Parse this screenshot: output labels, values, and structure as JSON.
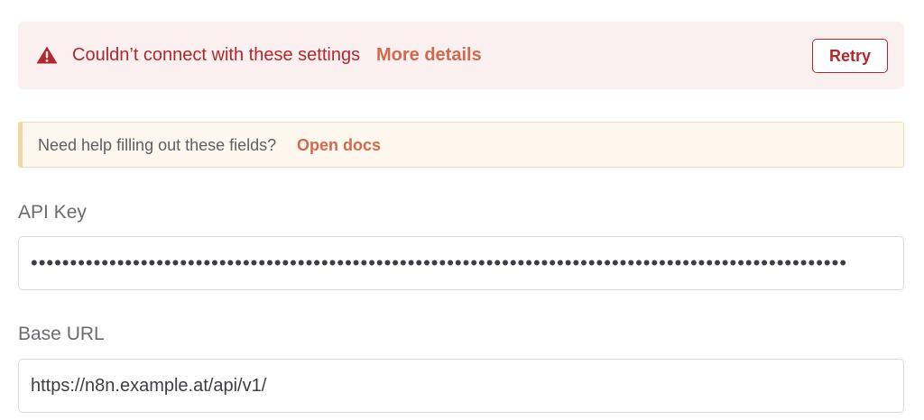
{
  "error_banner": {
    "message": "Couldn’t connect with these settings",
    "details_link": "More details",
    "retry_label": "Retry",
    "icon": "warning-triangle-icon",
    "color": "#b3272c",
    "background": "#fbf0f0"
  },
  "help_callout": {
    "text": "Need help filling out these fields?",
    "link": "Open docs",
    "background": "#fdf7ee",
    "accent": "#f0d6a6"
  },
  "fields": {
    "api_key": {
      "label": "API Key",
      "value": "••••••••••••••••••••••••••••••••••••••••••••••••••••••••••••••••••••••••••••••••••••••••••••••••••••••••"
    },
    "base_url": {
      "label": "Base URL",
      "value": "https://n8n.example.at/api/v1/"
    }
  },
  "colors": {
    "link": "#d2694f",
    "label": "#6b6b73",
    "border": "#d9d9de"
  }
}
